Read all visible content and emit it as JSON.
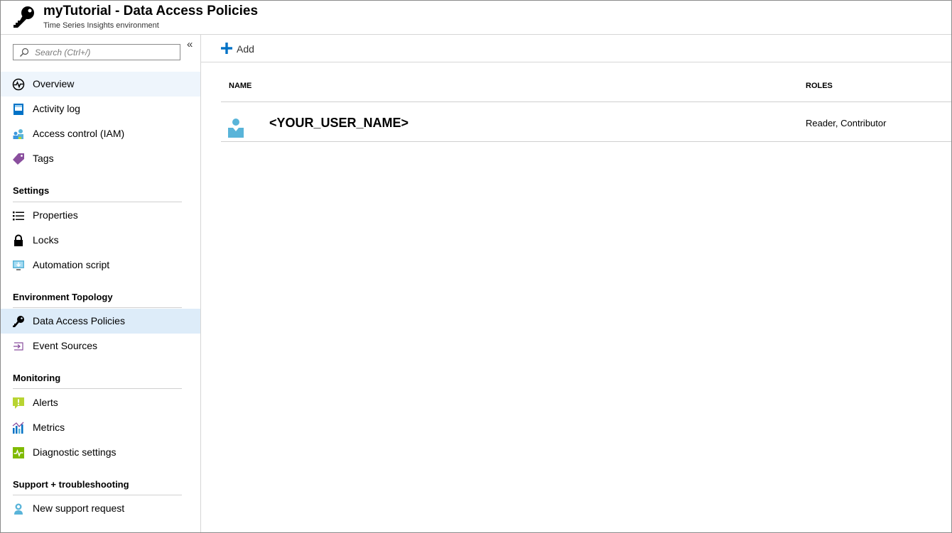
{
  "header": {
    "title": "myTutorial - Data Access Policies",
    "subtitle": "Time Series Insights environment",
    "icon": "key-icon"
  },
  "sidebar": {
    "search": {
      "placeholder": "Search (Ctrl+/)",
      "value": ""
    },
    "collapse_label": "«",
    "top_items": [
      {
        "label": "Overview",
        "icon": "overview-icon",
        "active": false
      },
      {
        "label": "Activity log",
        "icon": "activity-log-icon",
        "active": false
      },
      {
        "label": "Access control (IAM)",
        "icon": "iam-icon",
        "active": false
      },
      {
        "label": "Tags",
        "icon": "tag-icon",
        "active": false
      }
    ],
    "sections": [
      {
        "title": "Settings",
        "items": [
          {
            "label": "Properties",
            "icon": "properties-icon"
          },
          {
            "label": "Locks",
            "icon": "lock-icon"
          },
          {
            "label": "Automation script",
            "icon": "automation-script-icon"
          }
        ]
      },
      {
        "title": "Environment Topology",
        "items": [
          {
            "label": "Data Access Policies",
            "icon": "key-icon",
            "active": true
          },
          {
            "label": "Event Sources",
            "icon": "event-sources-icon"
          }
        ]
      },
      {
        "title": "Monitoring",
        "items": [
          {
            "label": "Alerts",
            "icon": "alert-icon"
          },
          {
            "label": "Metrics",
            "icon": "metrics-icon"
          },
          {
            "label": "Diagnostic settings",
            "icon": "diagnostic-settings-icon"
          }
        ]
      },
      {
        "title": "Support + troubleshooting",
        "items": [
          {
            "label": "New support request",
            "icon": "support-request-icon"
          }
        ]
      }
    ]
  },
  "toolbar": {
    "add_label": "Add"
  },
  "table": {
    "columns": [
      "NAME",
      "ROLES"
    ],
    "rows": [
      {
        "name": "<YOUR_USER_NAME>",
        "roles": "Reader, Contributor",
        "icon": "user-icon"
      }
    ]
  },
  "colors": {
    "active_bg": "#ddecf9",
    "accent_blue": "#0072c6",
    "user_icon": "#59b4d9"
  }
}
